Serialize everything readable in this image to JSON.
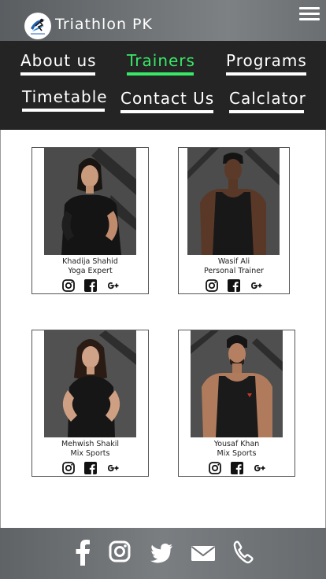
{
  "header": {
    "site_title": "Triathlon PK",
    "logo_icon": "runner-logo-icon",
    "menu_icon": "hamburger-menu-icon"
  },
  "nav": {
    "items": [
      {
        "label": "About us"
      },
      {
        "label": "Trainers",
        "active": true
      },
      {
        "label": "Programs"
      },
      {
        "label": "Timetable"
      },
      {
        "label": "Contact Us"
      },
      {
        "label": "Calclator"
      }
    ],
    "active_color": "#39e867"
  },
  "trainers": [
    {
      "name": "Khadija Shahid",
      "role": "Yoga Expert"
    },
    {
      "name": "Wasif Ali",
      "role": "Personal Trainer"
    },
    {
      "name": "Mehwish Shakil",
      "role": "Mix Sports"
    },
    {
      "name": "Yousaf Khan",
      "role": "Mix Sports"
    }
  ],
  "card_social_icons": [
    "instagram-icon",
    "facebook-icon",
    "google-plus-icon"
  ],
  "footer": {
    "icons": [
      "facebook-icon",
      "instagram-icon",
      "twitter-icon",
      "mail-icon",
      "phone-icon"
    ]
  }
}
